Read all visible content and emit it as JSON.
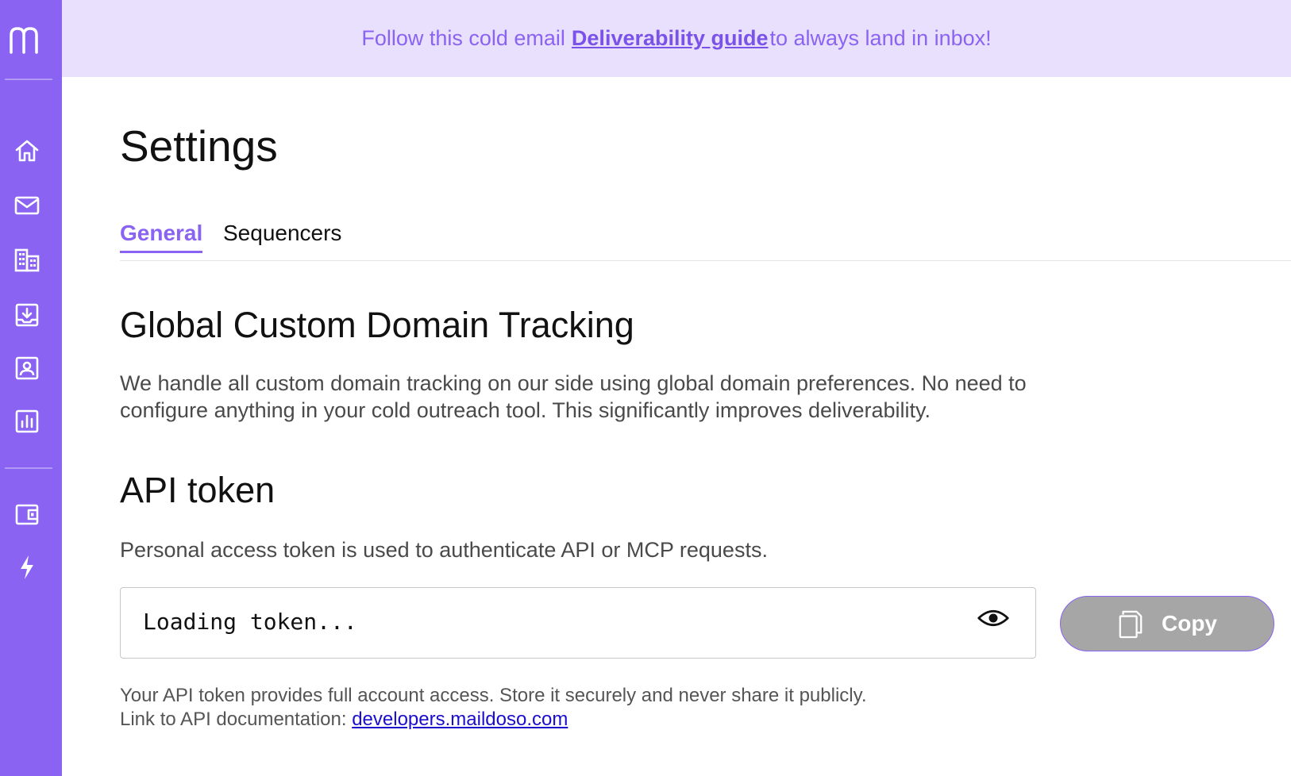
{
  "brand": {
    "accent": "#8a63f2",
    "banner_bg": "#e9e0fd",
    "logo_icon": "maildoso-m-logo-icon"
  },
  "sidebar": {
    "items": [
      {
        "icon": "home-icon"
      },
      {
        "icon": "mail-icon"
      },
      {
        "icon": "building-icon"
      },
      {
        "icon": "inbox-download-icon"
      },
      {
        "icon": "contact-icon"
      },
      {
        "icon": "analytics-chart-icon"
      },
      {
        "icon": "wallet-icon"
      },
      {
        "icon": "lightning-icon"
      }
    ]
  },
  "banner": {
    "text_before": "Follow this cold email",
    "link_text": "Deliverability guide",
    "text_after": "to always land in inbox!"
  },
  "page": {
    "title": "Settings"
  },
  "tabs": [
    {
      "label": "General",
      "active": true
    },
    {
      "label": "Sequencers",
      "active": false
    }
  ],
  "tracking": {
    "heading": "Global Custom Domain Tracking",
    "description": "We handle all custom domain tracking on our side using global domain preferences. No need to configure anything in your cold outreach tool. This significantly improves deliverability."
  },
  "api_token": {
    "heading": "API token",
    "description": "Personal access token is used to authenticate API or MCP requests.",
    "token_value": "Loading token...",
    "eye_icon": "eye-icon",
    "copy_label": "Copy",
    "copy_icon": "copy-icon",
    "note": "Your API token provides full account access. Store it securely and never share it publicly.",
    "doc_prefix": "Link to API documentation:",
    "doc_link": "developers.maildoso.com"
  }
}
